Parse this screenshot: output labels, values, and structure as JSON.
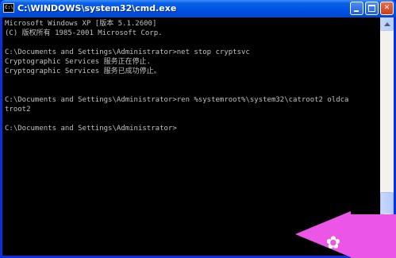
{
  "window": {
    "title": "C:\\WINDOWS\\system32\\cmd.exe",
    "app_icon_text": "C:\\"
  },
  "console": {
    "lines": [
      "Microsoft Windows XP [版本 5.1.2600]",
      "(C) 版权所有 1985-2001 Microsoft Corp.",
      "",
      "C:\\Documents and Settings\\Administrator>net stop cryptsvc",
      "Cryptographic Services 服务正在停止.",
      "Cryptographic Services 服务已成功停止。",
      "",
      "",
      "C:\\Documents and Settings\\Administrator>ren %systemroot%\\system32\\catroot2 oldca",
      "troot2",
      "",
      "C:\\Documents and Settings\\Administrator>"
    ]
  },
  "icons": {
    "minimize": "minimize-icon",
    "maximize": "maximize-icon",
    "close": "close-icon",
    "scroll_up": "arrow-up-icon",
    "scroll_down": "arrow-down-icon",
    "close_glyph": "✕"
  },
  "colors": {
    "console_bg": "#000000",
    "console_fg": "#c0c0c0",
    "titlebar": "#0054e3",
    "watermark": "#eb56e6"
  }
}
